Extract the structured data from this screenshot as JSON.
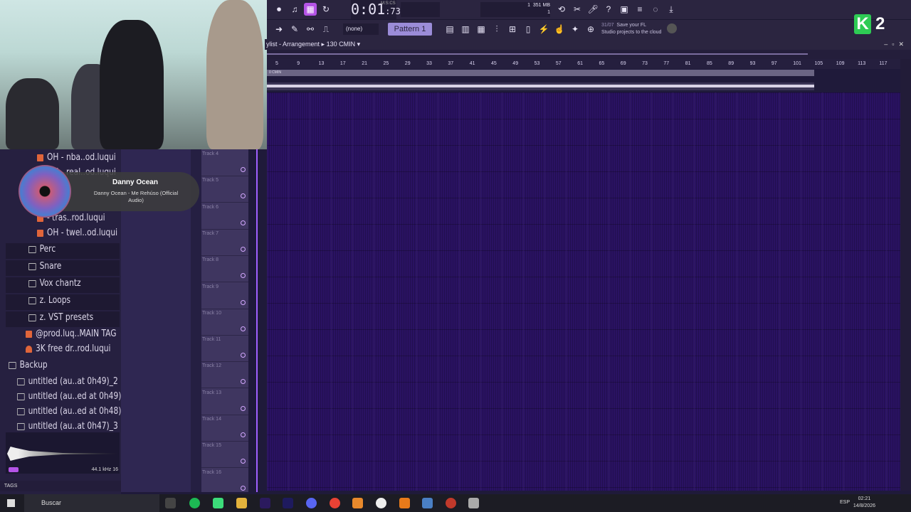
{
  "toolbar": {
    "time_main": "0:01",
    "time_sub": "73",
    "time_unit": "M:S:CS",
    "pattern_label": "Pattern 1",
    "channel_select": "(none)",
    "memory": "351 MB",
    "cpu_line1": "1",
    "cpu_line2": "1",
    "cloud_date": "31/07",
    "cloud_line1": "Save your FL",
    "cloud_line2": "Studio projects to the cloud"
  },
  "overlay_logo": {
    "letter": "K",
    "number": "2"
  },
  "playlist": {
    "title": "ylist - Arrangement",
    "pattern_label": "130 CMIN",
    "clip_label": "0 CMIN",
    "ruler_ticks": [
      "5",
      "9",
      "13",
      "17",
      "21",
      "25",
      "29",
      "33",
      "37",
      "41",
      "45",
      "49",
      "53",
      "57",
      "61",
      "65",
      "69",
      "73",
      "77",
      "81",
      "85",
      "89",
      "93",
      "97",
      "101",
      "105",
      "109",
      "113",
      "117"
    ],
    "tracks": [
      "Track 4",
      "Track 5",
      "Track 6",
      "Track 7",
      "Track 8",
      "Track 9",
      "Track 10",
      "Track 11",
      "Track 12",
      "Track 13",
      "Track 14",
      "Track 15",
      "Track 16"
    ]
  },
  "browser": {
    "items": [
      {
        "label": "OH - nba..od.luqui",
        "icon": "audio-icon"
      },
      {
        "label": "OH - real..od.luqui",
        "icon": "audio-icon"
      },
      {
        "label": "- tras..rod.luqui",
        "icon": "audio-icon"
      },
      {
        "label": "OH - twel..od.luqui",
        "icon": "audio-icon"
      },
      {
        "label": "Perc",
        "icon": "folder-icon"
      },
      {
        "label": "Snare",
        "icon": "folder-icon"
      },
      {
        "label": "Vox chantz",
        "icon": "folder-icon"
      },
      {
        "label": "z. Loops",
        "icon": "folder-icon"
      },
      {
        "label": "z. VST presets",
        "icon": "folder-icon"
      },
      {
        "label": "@prod.luq..MAIN TAG",
        "icon": "audio-icon"
      },
      {
        "label": "3K free dr..rod.luqui",
        "icon": "flame-icon"
      },
      {
        "label": "Backup",
        "icon": "folder-open-icon"
      },
      {
        "label": "untitled (au..at 0h49)_2",
        "icon": "project-icon"
      },
      {
        "label": "untitled (au..ed at 0h49)",
        "icon": "project-icon"
      },
      {
        "label": "untitled (au..ed at 0h48)",
        "icon": "project-icon"
      },
      {
        "label": "untitled (au..at 0h47)_3",
        "icon": "project-icon"
      }
    ],
    "sample_rate": "44.1 kHz 16",
    "tags_label": "TAGS"
  },
  "now_playing": {
    "artist": "Danny Ocean",
    "song": "Danny Ocean - Me Rehúso (Official Audio)"
  },
  "taskbar": {
    "search_placeholder": "Buscar",
    "lang": "ESP",
    "time": "02:21",
    "date": "14/8/2026"
  },
  "colors": {
    "accent": "#b454e6",
    "playlist_bg": "#2a1262",
    "toolbar_bg": "#2b2540"
  }
}
